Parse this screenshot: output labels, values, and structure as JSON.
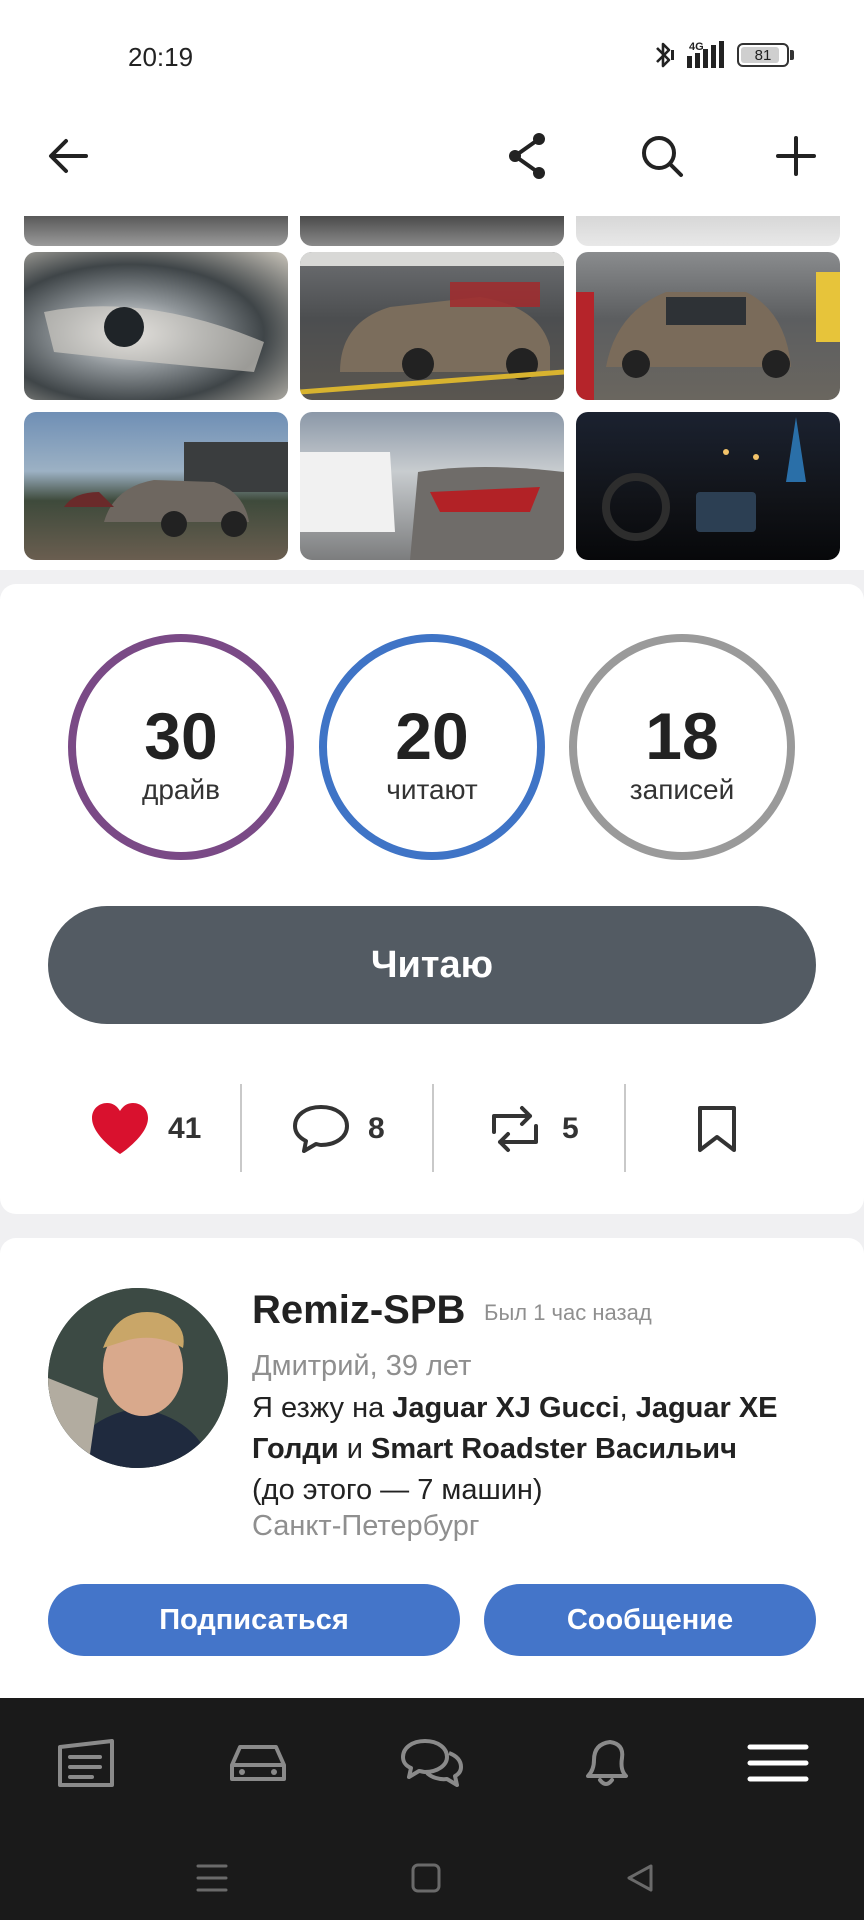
{
  "status": {
    "time": "20:19",
    "network": "4G",
    "battery": "81"
  },
  "topbar": {
    "back_icon": "arrow-left-icon",
    "share_icon": "share-icon",
    "search_icon": "search-icon",
    "add_icon": "plus-icon"
  },
  "gallery": {
    "photos": [
      "car-engine-bay-photo",
      "car-interior-photo",
      "car-dashboard-photo",
      "car-headlight-closeup-photo",
      "jaguar-in-parking-garage-side-photo",
      "jaguar-in-parking-garage-front-photo",
      "jaguar-on-country-road-photo",
      "jaguar-taillight-parked-photo",
      "car-interior-night-photo"
    ]
  },
  "stats": [
    {
      "value": "30",
      "label": "драйв",
      "color": "#7a4a86"
    },
    {
      "value": "20",
      "label": "читают",
      "color": "#3f74c6"
    },
    {
      "value": "18",
      "label": "записей",
      "color": "#9a9a9a"
    }
  ],
  "read_button": "Читаю",
  "actions": {
    "likes": "41",
    "comments": "8",
    "reposts": "5"
  },
  "profile": {
    "username": "Remiz-SPB",
    "last_seen": "Был 1 час назад",
    "name_age": "Дмитрий, 39 лет",
    "bio": {
      "p1": "Я езжу на ",
      "car1": "Jaguar XJ Gucci",
      "p2": ", ",
      "car2": "Jaguar XE Голди",
      "p3": " и ",
      "car3": "Smart Roadster Васильич",
      "p4": "(до этого — 7 машин)"
    },
    "city": "Санкт-Петербург",
    "subscribe_button": "Подписаться",
    "message_button": "Сообщение"
  },
  "colors": {
    "accent_blue": "#4475c9",
    "read_button": "#535b63",
    "like_red": "#d9112e",
    "nav_bg": "#1a1a1a"
  },
  "bottom_nav": [
    "feed-icon",
    "car-icon",
    "chats-icon",
    "bell-icon",
    "menu-icon"
  ],
  "system_nav": [
    "recents-icon",
    "home-icon",
    "back-icon"
  ]
}
